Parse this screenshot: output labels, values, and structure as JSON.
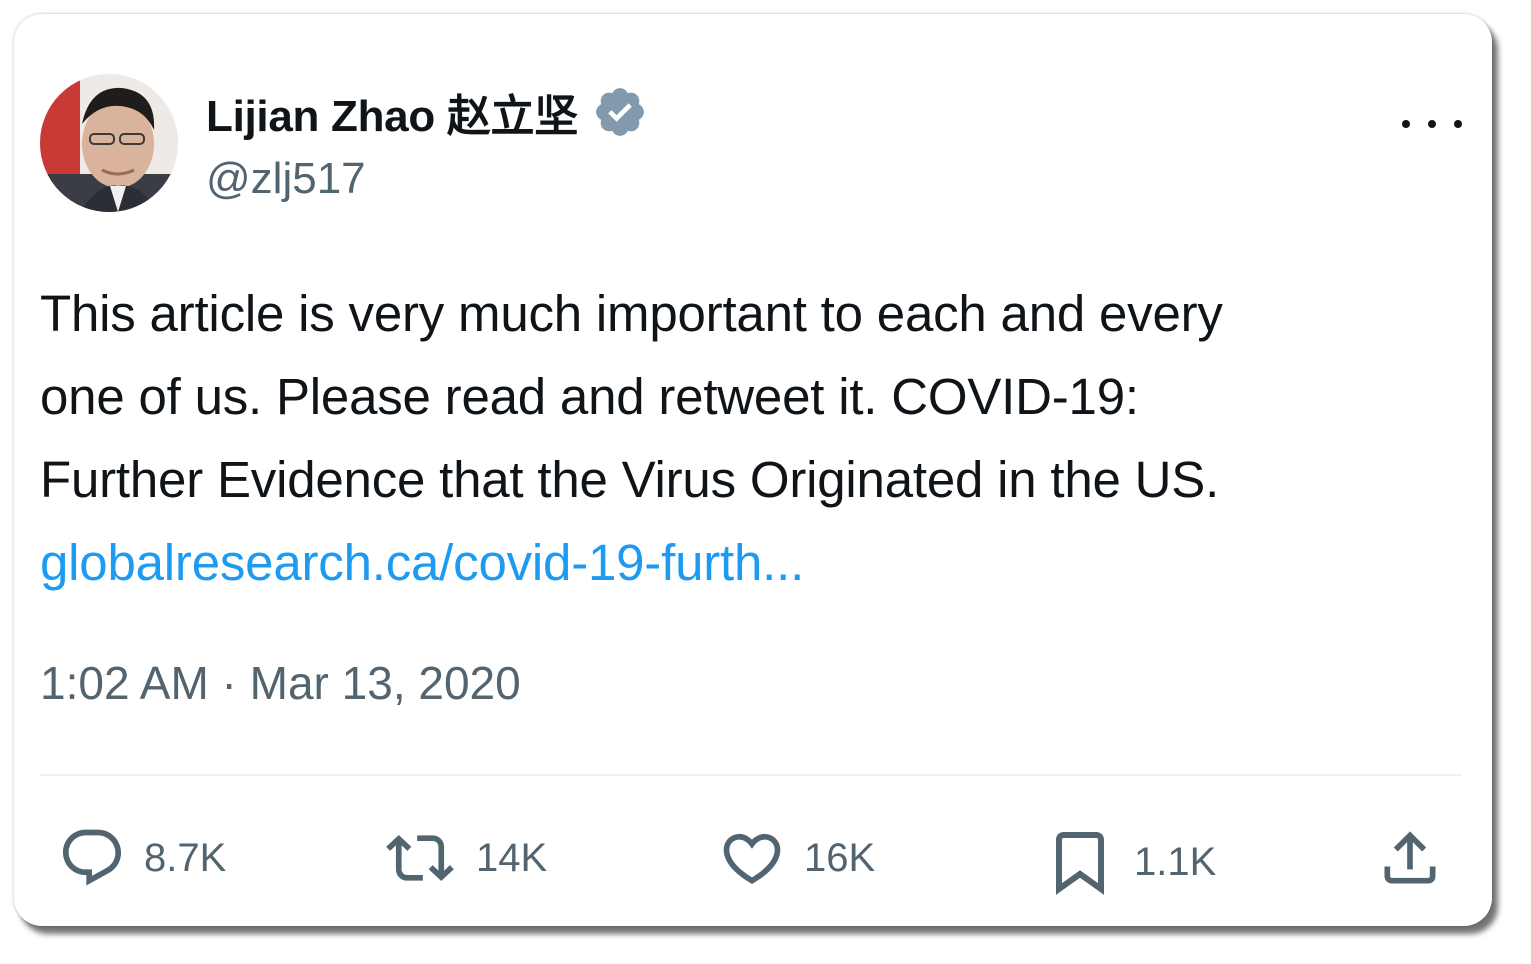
{
  "author": {
    "display_name": "Lijian Zhao 赵立坚",
    "handle": "@zlj517",
    "verified_icon": "verified-badge-icon"
  },
  "tweet": {
    "text_lines": [
      "This article is very much important to each and every",
      "one of us. Please read and retweet it. COVID-19:",
      "Further Evidence that the Virus Originated in the US."
    ],
    "link_text": "globalresearch.ca/covid-19-furth...",
    "timestamp": "1:02 AM · Mar 13, 2020"
  },
  "metrics": {
    "replies": "8.7K",
    "retweets": "14K",
    "likes": "16K",
    "bookmarks": "1.1K"
  },
  "colors": {
    "text": "#0f1419",
    "secondary": "#536471",
    "link": "#1d9bf0",
    "verified_badge": "#829aab"
  }
}
